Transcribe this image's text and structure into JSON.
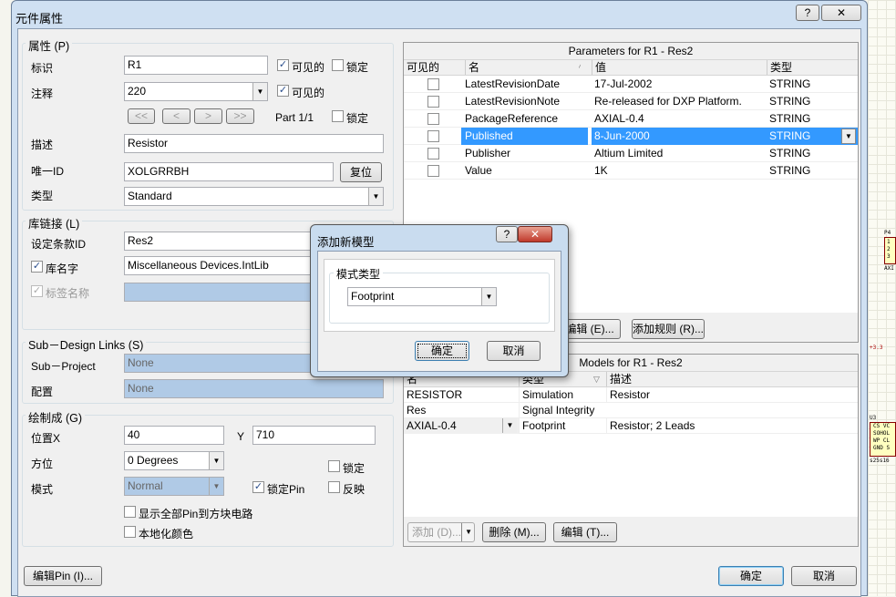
{
  "window": {
    "title": "元件属性",
    "help": "?",
    "close": "✕"
  },
  "props": {
    "group": "属性 (P)",
    "id_label": "标识",
    "id_value": "R1",
    "visible": "可见的",
    "lock": "锁定",
    "comment_label": "注释",
    "comment_value": "220",
    "visible2": "可见的",
    "nav": [
      "<<",
      "<",
      ">",
      ">>"
    ],
    "part": "Part 1/1",
    "lock2": "锁定",
    "desc_label": "描述",
    "desc_value": "Resistor",
    "uid_label": "唯一ID",
    "uid_value": "XOLGRRBH",
    "reset": "复位",
    "type_label": "类型",
    "type_value": "Standard"
  },
  "lib": {
    "group": "库链接 (L)",
    "design_id_label": "设定条款ID",
    "design_id_value": "Res2",
    "libname_label": "库名字",
    "libname_value": "Miscellaneous Devices.IntLib",
    "tag_label": "标签名称"
  },
  "sub": {
    "group": "Sub－Design Links (S)",
    "project_label": "Sub－Project",
    "project_value": "None",
    "config_label": "配置",
    "config_value": "None"
  },
  "graph": {
    "group": "绘制成 (G)",
    "posx_label": "位置X",
    "posx_value": "40",
    "y_label": "Y",
    "y_value": "710",
    "orient_label": "方位",
    "orient_value": "0 Degrees",
    "lock": "锁定",
    "mode_label": "模式",
    "mode_value": "Normal",
    "lockpin": "锁定Pin",
    "mirror": "反映",
    "showall": "显示全部Pin到方块电路",
    "localcolor": "本地化颜色"
  },
  "params": {
    "title": "Parameters for R1 - Res2",
    "headers": [
      "可见的",
      "名",
      "值",
      "类型"
    ],
    "rows": [
      {
        "name": "LatestRevisionDate",
        "value": "17-Jul-2002",
        "type": "STRING"
      },
      {
        "name": "LatestRevisionNote",
        "value": "Re-released for DXP Platform.",
        "type": "STRING"
      },
      {
        "name": "PackageReference",
        "value": "AXIAL-0.4",
        "type": "STRING"
      },
      {
        "name": "Published",
        "value": "8-Jun-2000",
        "type": "STRING"
      },
      {
        "name": "Publisher",
        "value": "Altium Limited",
        "type": "STRING"
      },
      {
        "name": "Value",
        "value": "1K",
        "type": "STRING"
      }
    ],
    "edit": "编辑 (E)...",
    "add_rule": "添加规则 (R)..."
  },
  "models": {
    "title": "Models for R1 - Res2",
    "headers": [
      "名",
      "类型",
      "描述"
    ],
    "rows": [
      {
        "name": "RESISTOR",
        "type": "Simulation",
        "desc": "Resistor"
      },
      {
        "name": "Res",
        "type": "Signal Integrity",
        "desc": ""
      },
      {
        "name": "AXIAL-0.4",
        "type": "Footprint",
        "desc": "Resistor; 2 Leads"
      }
    ],
    "add": "添加 (D)...",
    "remove": "删除 (M)...",
    "edit": "编辑 (T)..."
  },
  "footer": {
    "edit_pin": "编辑Pin (I)...",
    "ok": "确定",
    "cancel": "取消"
  },
  "modal": {
    "title": "添加新模型",
    "help": "?",
    "close": "✕",
    "group": "模式类型",
    "value": "Footprint",
    "ok": "确定",
    "cancel": "取消"
  },
  "schematic": {
    "labels": [
      "P4",
      "1",
      "2",
      "3",
      "AXI",
      "+3.3",
      "U3",
      "CS VC",
      "SOHOL",
      "WP CL",
      "GND S",
      "s25s16"
    ]
  }
}
